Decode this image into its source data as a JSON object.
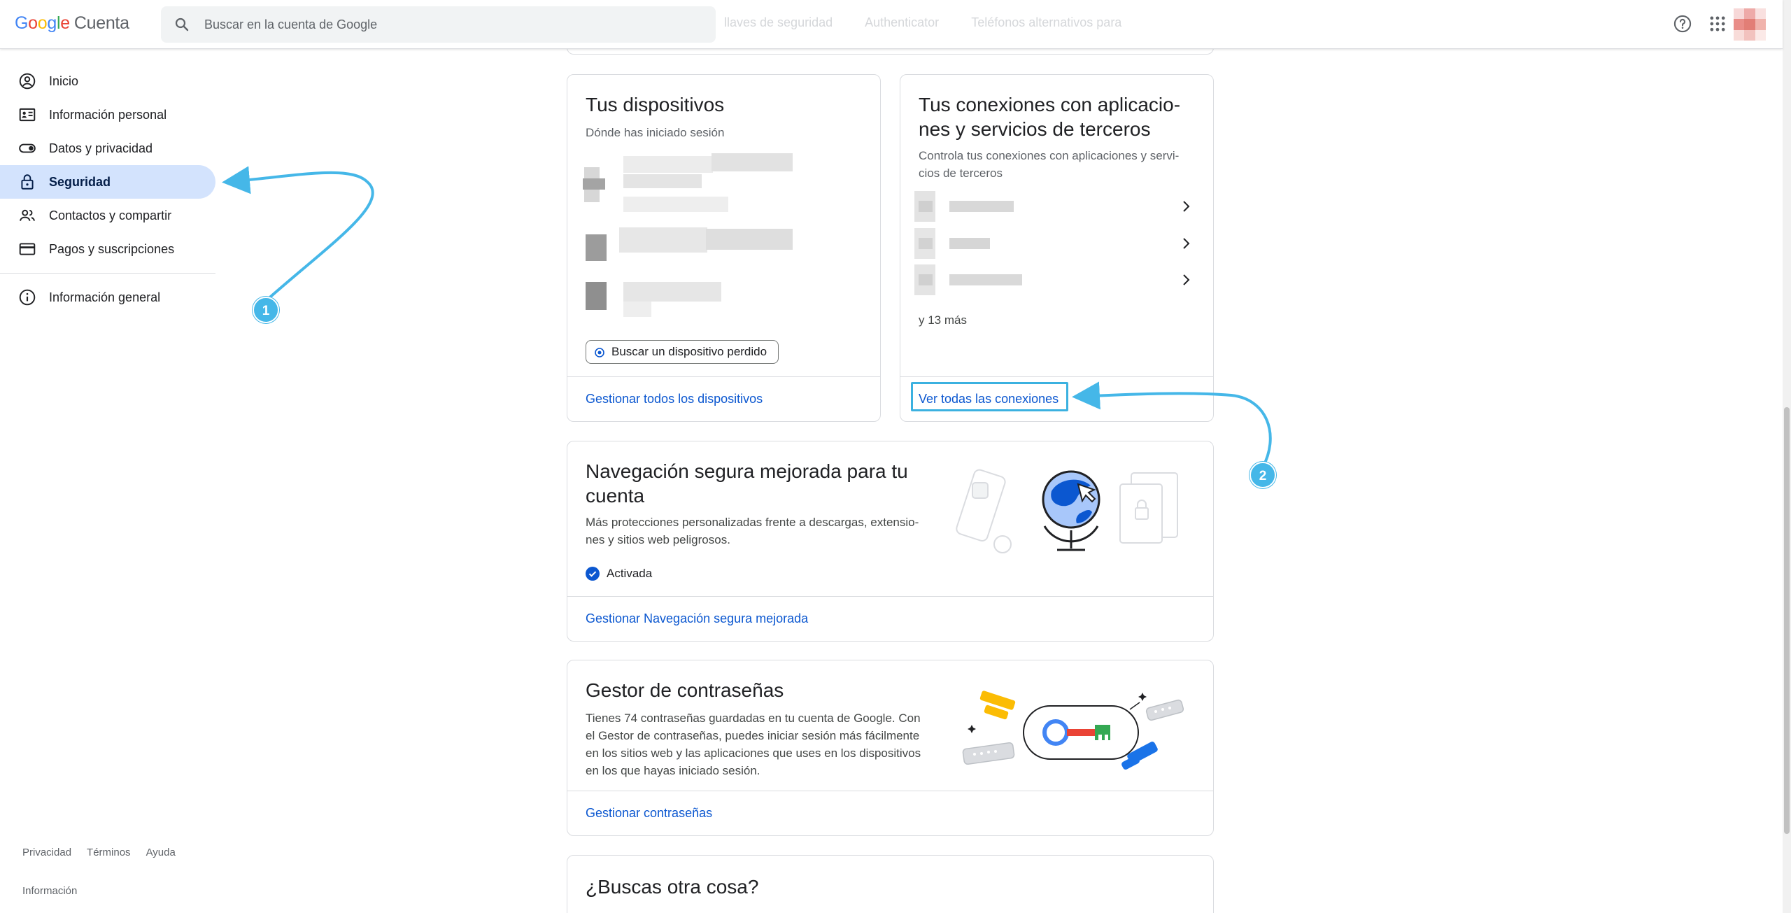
{
  "header": {
    "logo_google": [
      "G",
      "o",
      "o",
      "g",
      "l",
      "e"
    ],
    "logo_cuenta": "Cuenta",
    "search_placeholder": "Buscar en la cuenta de Google",
    "ghost_tabs": [
      "llaves de seguridad",
      "Authenticator",
      "Teléfonos alternativos para"
    ],
    "icons": [
      "help-icon",
      "apps-grid-icon",
      "account-avatar"
    ]
  },
  "sidebar": {
    "items": [
      {
        "label": "Inicio",
        "icon": "home-icon",
        "active": false
      },
      {
        "label": "Información personal",
        "icon": "id-card-icon",
        "active": false
      },
      {
        "label": "Datos y privacidad",
        "icon": "toggle-icon",
        "active": false
      },
      {
        "label": "Seguridad",
        "icon": "lock-icon",
        "active": true
      },
      {
        "label": "Contactos y compartir",
        "icon": "people-icon",
        "active": false
      },
      {
        "label": "Pagos y suscripciones",
        "icon": "credit-card-icon",
        "active": false
      }
    ],
    "general": {
      "label": "Información general",
      "icon": "info-icon"
    },
    "footer": {
      "privacy": "Privacidad",
      "terms": "Términos",
      "help": "Ayuda",
      "info": "Información"
    }
  },
  "devices_card": {
    "title": "Tus dispositivos",
    "subtitle": "Dónde has iniciado sesión",
    "find_button": "Buscar un dispositivo perdido",
    "footer_link": "Gestionar todos los dispositivos"
  },
  "connections_card": {
    "title_line1": "Tus conexiones con aplicacio-",
    "title_line2": "nes y servicios de terceros",
    "subtitle_line1": "Controla tus conexiones con aplicaciones y servi-",
    "subtitle_line2": "cios de terceros",
    "more": "y 13 más",
    "footer_link": "Ver todas las conexiones"
  },
  "safe_browsing_card": {
    "title_line1": "Navegación segura mejorada para tu",
    "title_line2": "cuenta",
    "desc_line1": "Más protecciones personalizadas frente a descargas, extensio-",
    "desc_line2": "nes y sitios web peligrosos.",
    "status": "Activada",
    "footer_link": "Gestionar Navegación segura mejorada"
  },
  "password_card": {
    "title": "Gestor de contraseñas",
    "desc_lines": [
      "Tienes 74 contraseñas guardadas en tu cuenta de Google. Con",
      "el Gestor de contraseñas, puedes iniciar sesión más fácilmente",
      "en los sitios web y las aplicaciones que uses en los dispositivos",
      "en los que hayas iniciado sesión."
    ],
    "footer_link": "Gestionar contraseñas"
  },
  "other_card": {
    "title": "¿Buscas otra cosa?"
  },
  "annotations": {
    "badge1": "1",
    "badge2": "2"
  },
  "colors": {
    "accent": "#0b57d0",
    "active_nav": "#d3e3fd",
    "annotation": "#45b7e8"
  }
}
